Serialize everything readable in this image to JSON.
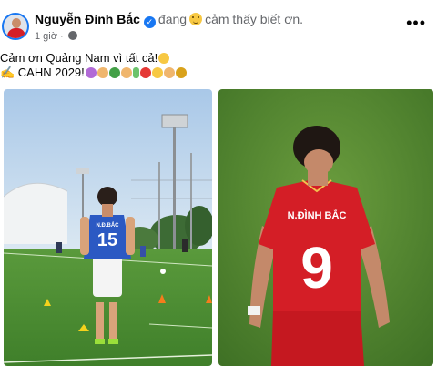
{
  "post": {
    "author": "Nguyễn Đình Bắc",
    "activity": "đang",
    "feeling": "cảm thấy biết ơn.",
    "time": "1 giờ",
    "meta_sep": "·",
    "text_line1": "Cảm ơn Quảng Nam vì tất cả!",
    "text_line2": "✍️ CAHN 2029!"
  },
  "photos": {
    "left_jersey_name": "N.Đ.BẮC",
    "left_jersey_number": "15",
    "right_jersey_name": "N.ĐÌNH BẮC",
    "right_jersey_number": "9"
  },
  "colors": {
    "verified": "#1877f2",
    "secondary_text": "#65676b",
    "jersey_red": "#d41e26",
    "jersey_blue": "#2b59c3"
  },
  "icons": [
    "verified-icon",
    "smiling-face-icon",
    "globe-icon",
    "more-options-icon"
  ]
}
